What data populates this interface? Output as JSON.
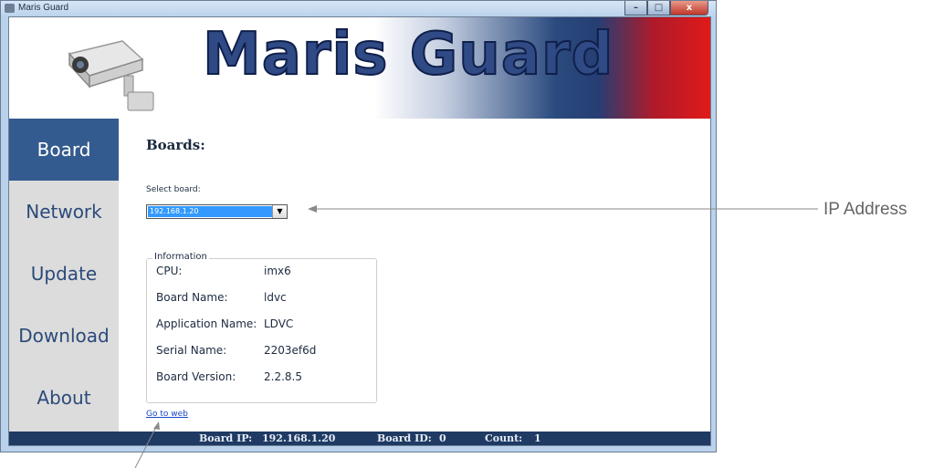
{
  "window": {
    "title": "Maris Guard",
    "controls": [
      "–",
      "□",
      "x"
    ]
  },
  "banner": {
    "title": "Maris Guard"
  },
  "sidebar": {
    "items": [
      {
        "label": "Board",
        "active": true
      },
      {
        "label": "Network"
      },
      {
        "label": "Update"
      },
      {
        "label": "Download"
      },
      {
        "label": "About"
      }
    ]
  },
  "main": {
    "heading": "Boards:",
    "select_label": "Select board:",
    "select_value": "192.168.1.20",
    "info": {
      "group_label": "Information",
      "rows": [
        {
          "key": "CPU:",
          "value": "imx6"
        },
        {
          "key": "Board Name:",
          "value": "ldvc"
        },
        {
          "key": "Application Name:",
          "value": "LDVC"
        },
        {
          "key": "Serial Name:",
          "value": "2203ef6d"
        },
        {
          "key": "Board Version:",
          "value": "2.2.8.5"
        }
      ]
    },
    "link": "Go to web"
  },
  "status": {
    "board_ip_label": "Board IP:",
    "board_ip": "192.168.1.20",
    "board_id_label": "Board ID:",
    "board_id": "0",
    "count_label": "Count:",
    "count": "1"
  },
  "annotation": {
    "label": "IP Address"
  },
  "colors": {
    "accent": "#345b8f",
    "status_bar": "#1f3a63",
    "link": "#1a47c9"
  }
}
